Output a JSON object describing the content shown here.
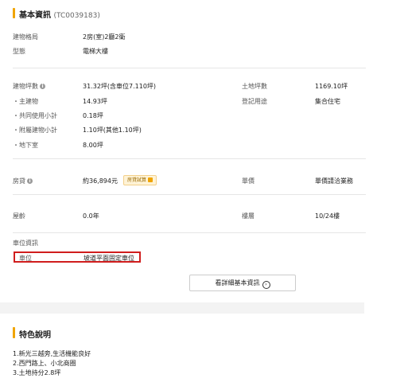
{
  "basic_info": {
    "title": "基本資訊",
    "code": "(TC0039183)",
    "rows_top": [
      {
        "label": "建物格局",
        "value": "2房(室)2廳2衛"
      },
      {
        "label": "型態",
        "value": "電梯大樓"
      }
    ],
    "area": {
      "main_label": "建物坪數",
      "main_value": "31.32坪(含車位7.110坪)",
      "sub_rows": [
        {
          "label": "・主建物",
          "value": "14.93坪"
        },
        {
          "label": "・共同使用小計",
          "value": "0.18坪"
        },
        {
          "label": "・附屬建物小計",
          "value": "1.10坪(其他1.10坪)"
        },
        {
          "label": "・地下室",
          "value": "8.00坪"
        }
      ],
      "right_rows": [
        {
          "label": "土地坪數",
          "value": "1169.10坪"
        },
        {
          "label": "登記用途",
          "value": "集合住宅"
        }
      ]
    },
    "loan": {
      "label": "房貸",
      "value": "約36,894元",
      "badge": "房貸試算",
      "right_label": "單價",
      "right_value": "單價請洽業務"
    },
    "age": {
      "label": "屋齡",
      "value": "0.0年",
      "right_label": "樓層",
      "right_value": "10/24樓"
    },
    "parking": {
      "section_label": "車位資訊",
      "label": "車位",
      "value": "坡道平面固定車位"
    },
    "detail_button": "看詳細基本資訊",
    "info_icon_glyph": "i",
    "arrow_glyph": "›"
  },
  "features": {
    "title": "特色說明",
    "lines": [
      "1.新光三越旁,生活機能良好",
      "2.西門路上、小北商圈",
      "3.土地持分2.8坪"
    ]
  },
  "colors": {
    "accent": "#f0a400",
    "highlight_border": "#d01d1d"
  }
}
